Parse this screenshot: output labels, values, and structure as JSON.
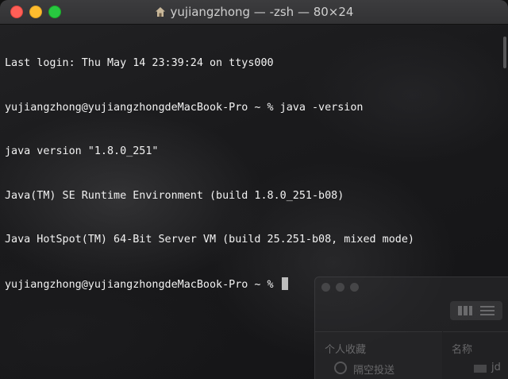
{
  "window": {
    "title": "yujiangzhong — -zsh — 80×24"
  },
  "terminal": {
    "lines": [
      "Last login: Thu May 14 23:39:24 on ttys000",
      "yujiangzhong@yujiangzhongdeMacBook-Pro ~ % java -version",
      "java version \"1.8.0_251\"",
      "Java(TM) SE Runtime Environment (build 1.8.0_251-b08)",
      "Java HotSpot(TM) 64-Bit Server VM (build 25.251-b08, mixed mode)",
      "yujiangzhong@yujiangzhongdeMacBook-Pro ~ % "
    ]
  },
  "finder": {
    "sidebar_heading": "个人收藏",
    "sidebar_item_airdrop": "隔空投送",
    "column_name": "名称",
    "file_partial": "jd"
  },
  "colors": {
    "close": "#fe5f57",
    "minimize": "#febc2e",
    "maximize": "#28c840"
  }
}
